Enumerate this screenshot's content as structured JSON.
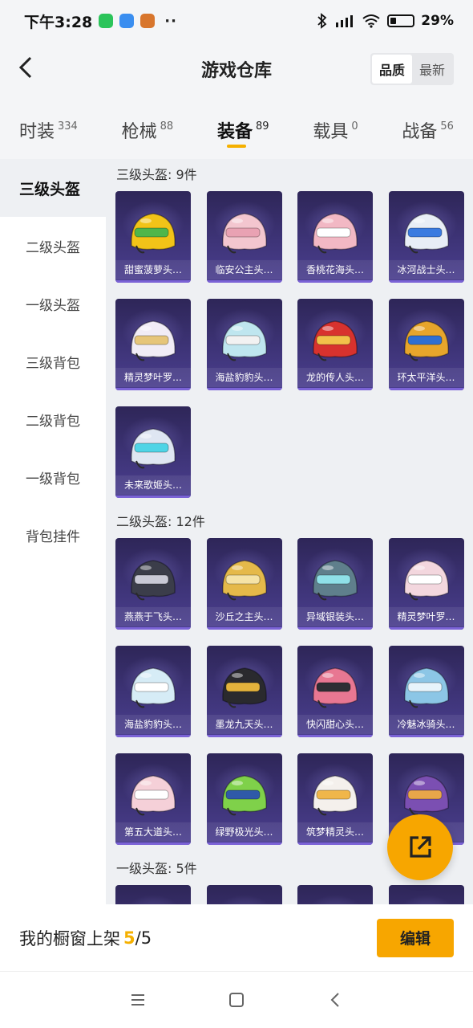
{
  "status_bar": {
    "time": "下午3:28",
    "battery": "29%"
  },
  "header": {
    "title": "游戏仓库",
    "sort_quality": "品质",
    "sort_newest": "最新"
  },
  "tabs": [
    {
      "label": "时装",
      "count": "334"
    },
    {
      "label": "枪械",
      "count": "88"
    },
    {
      "label": "装备",
      "count": "89"
    },
    {
      "label": "载具",
      "count": "0"
    },
    {
      "label": "战备",
      "count": "56"
    }
  ],
  "sidebar": {
    "items": [
      {
        "label": "三级头盔"
      },
      {
        "label": "二级头盔"
      },
      {
        "label": "一级头盔"
      },
      {
        "label": "三级背包"
      },
      {
        "label": "二级背包"
      },
      {
        "label": "一级背包"
      },
      {
        "label": "背包挂件"
      }
    ]
  },
  "sections": [
    {
      "title": "三级头盔: 9件",
      "items": [
        {
          "name": "甜蜜菠萝头…",
          "color": "#f2c318",
          "accent": "#4fb64a"
        },
        {
          "name": "临安公主头…",
          "color": "#f3c6cf",
          "accent": "#e9a2b3"
        },
        {
          "name": "香桃花海头…",
          "color": "#f2b8c4",
          "accent": "#ffffff"
        },
        {
          "name": "冰河战士头…",
          "color": "#e8eef6",
          "accent": "#3a7be0"
        },
        {
          "name": "精灵梦叶罗…",
          "color": "#f1ecf6",
          "accent": "#e6c57a"
        },
        {
          "name": "海盐豹豹头…",
          "color": "#bfe6ef",
          "accent": "#f2f2f2"
        },
        {
          "name": "龙的传人头…",
          "color": "#d8322e",
          "accent": "#f2c14a"
        },
        {
          "name": "环太平洋头…",
          "color": "#e7a52b",
          "accent": "#2f6fd1"
        },
        {
          "name": "未来歌姬头…",
          "color": "#dfe6f2",
          "accent": "#4fd4e6"
        }
      ]
    },
    {
      "title": "二级头盔: 12件",
      "items": [
        {
          "name": "燕燕于飞头…",
          "color": "#3b3d4a",
          "accent": "#c9c9d6"
        },
        {
          "name": "沙丘之主头…",
          "color": "#e5b94a",
          "accent": "#f5e3a6"
        },
        {
          "name": "异域银装头…",
          "color": "#5f7f8c",
          "accent": "#8fe0e8"
        },
        {
          "name": "精灵梦叶罗…",
          "color": "#f3d7de",
          "accent": "#ffffff"
        },
        {
          "name": "海盐豹豹头…",
          "color": "#d6ecf6",
          "accent": "#ffffff"
        },
        {
          "name": "墨龙九天头…",
          "color": "#2a2a2e",
          "accent": "#e3b23c"
        },
        {
          "name": "快闪甜心头…",
          "color": "#e87792",
          "accent": "#2e2e34"
        },
        {
          "name": "冷魅冰骑头…",
          "color": "#8cc6e6",
          "accent": "#e7f4fb"
        },
        {
          "name": "第五大道头…",
          "color": "#f5d0d8",
          "accent": "#ffffff"
        },
        {
          "name": "绿野极光头…",
          "color": "#7fd14a",
          "accent": "#2f5aa8"
        },
        {
          "name": "筑梦精灵头…",
          "color": "#f4f0ec",
          "accent": "#f0b64a"
        },
        {
          "name": "",
          "color": "#7b4fb2",
          "accent": "#e8a64a"
        }
      ]
    },
    {
      "title": "一级头盔: 5件",
      "items": [
        {
          "name": "",
          "color": "#6aa04a",
          "accent": "#ffffff"
        },
        {
          "name": "",
          "color": "#8a8fa6",
          "accent": "#ffffff"
        },
        {
          "name": "",
          "color": "#8a8fa6",
          "accent": "#ffffff"
        },
        {
          "name": "",
          "color": "#8a8fa6",
          "accent": "#ffffff"
        }
      ]
    }
  ],
  "shop_bar": {
    "label": "我的橱窗上架",
    "count": "5",
    "total": "/5",
    "edit": "编辑"
  }
}
